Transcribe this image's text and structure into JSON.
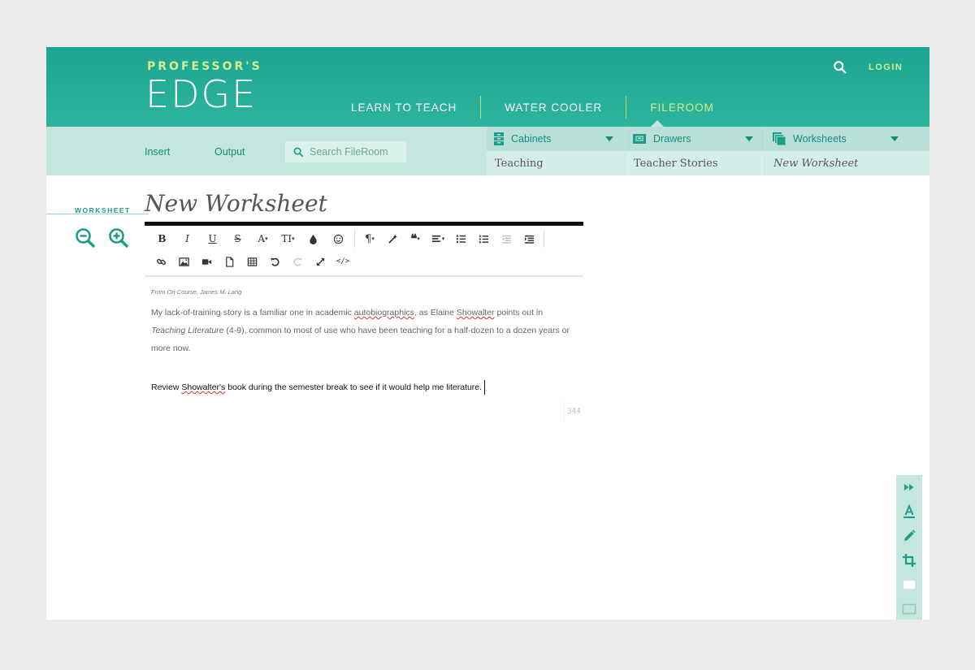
{
  "brand": {
    "top": "PROFESSOR'S",
    "main": "EDGE"
  },
  "header": {
    "login": "LOGIN",
    "nav": [
      "LEARN TO TEACH",
      "WATER COOLER",
      "FILEROOM"
    ],
    "active": "FILEROOM"
  },
  "subbar": {
    "insert": "Insert",
    "output": "Output",
    "search_placeholder": "Search FileRoom",
    "crumbs": [
      {
        "label": "Cabinets",
        "value": "Teaching",
        "icon": "cabinet-icon"
      },
      {
        "label": "Drawers",
        "value": "Teacher Stories",
        "icon": "drawer-icon"
      },
      {
        "label": "Worksheets",
        "value": "New Worksheet",
        "icon": "worksheets-icon"
      }
    ]
  },
  "worksheet": {
    "section_label": "WORKSHEET",
    "title": "New Worksheet",
    "citation": "From On Course, James M. Lang",
    "quote_part1": "My lack-of-training story is a familiar one in academic ",
    "quote_word1": "autobiographics",
    "quote_part2": ", as Elaine ",
    "quote_word2": "Showalter",
    "quote_part3": " points out in ",
    "quote_book": "Teaching Literature",
    "quote_part4": " (4-9), common to most of use who have been teaching for a half-dozen to a dozen years or more now.",
    "note_part1": "Review ",
    "note_word": "Showalter's",
    "note_part2": " book during the semester break to see if it would help me literature.",
    "char_count": "344"
  },
  "toolbar": {
    "bold": "B",
    "italic": "I",
    "underline": "U",
    "strike": "S",
    "font": "A",
    "size": "TI"
  },
  "colors": {
    "teal": "#1aa592",
    "lime": "#d8ec8c",
    "subbar": "#c4e6df"
  }
}
